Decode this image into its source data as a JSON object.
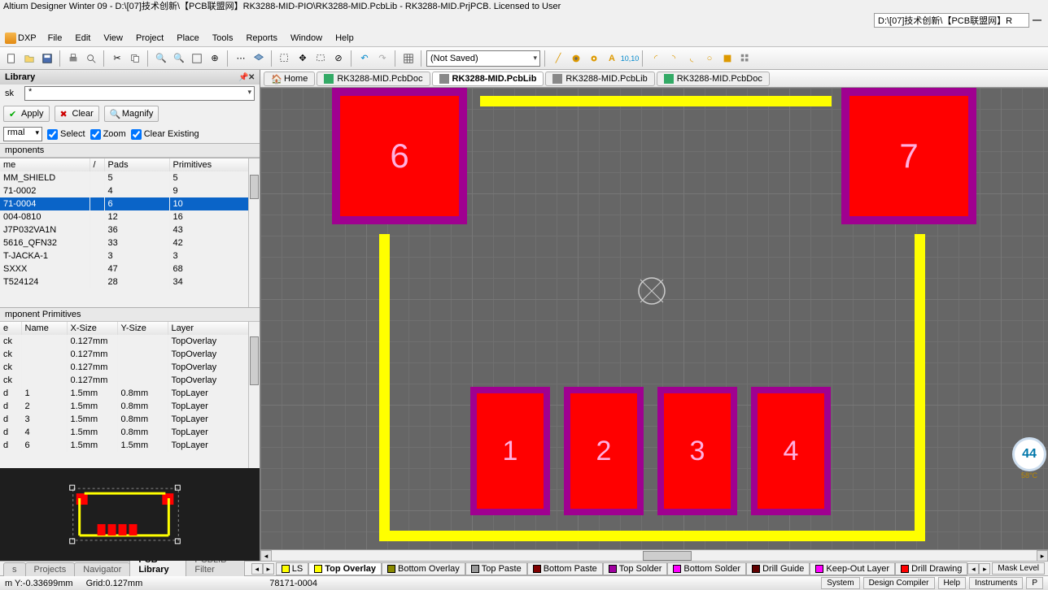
{
  "title": "Altium Designer Winter 09 - D:\\[07]技术创新\\【PCB联盟网】RK3288-MID-PIO\\RK3288-MID.PcbLib - RK3288-MID.PrjPCB. Licensed to User",
  "addr": "D:\\[07]技术创新\\【PCB联盟网】R",
  "menus": {
    "dxp": "DXP",
    "file": "File",
    "edit": "Edit",
    "view": "View",
    "project": "Project",
    "place": "Place",
    "tools": "Tools",
    "reports": "Reports",
    "window": "Window",
    "help": "Help"
  },
  "saved_combo": "(Not Saved)",
  "lib": {
    "title": "Library",
    "mask_label": "sk",
    "mask_value": "*",
    "apply": "Apply",
    "clear": "Clear",
    "magnify": "Magnify",
    "mode": "rmal",
    "chk_select": "Select",
    "chk_zoom": "Zoom",
    "chk_clear": "Clear Existing",
    "components_label": "mponents",
    "cols": {
      "name": "me",
      "pads": "Pads",
      "prims": "Primitives"
    },
    "rows": [
      {
        "name": "MM_SHIELD",
        "pads": "5",
        "prims": "5"
      },
      {
        "name": "71-0002",
        "pads": "4",
        "prims": "9"
      },
      {
        "name": "71-0004",
        "pads": "6",
        "prims": "10"
      },
      {
        "name": "004-0810",
        "pads": "12",
        "prims": "16"
      },
      {
        "name": "J7P032VA1N",
        "pads": "36",
        "prims": "43"
      },
      {
        "name": "5616_QFN32",
        "pads": "33",
        "prims": "42"
      },
      {
        "name": "T-JACKA-1",
        "pads": "3",
        "prims": "3"
      },
      {
        "name": "SXXX",
        "pads": "47",
        "prims": "68"
      },
      {
        "name": "T524124",
        "pads": "28",
        "prims": "34"
      }
    ],
    "prim_label": "mponent Primitives",
    "pcols": {
      "type": "e",
      "name": "Name",
      "xs": "X-Size",
      "ys": "Y-Size",
      "layer": "Layer"
    },
    "prows": [
      {
        "t": "ck",
        "n": "",
        "x": "0.127mm",
        "y": "",
        "l": "TopOverlay"
      },
      {
        "t": "ck",
        "n": "",
        "x": "0.127mm",
        "y": "",
        "l": "TopOverlay"
      },
      {
        "t": "ck",
        "n": "",
        "x": "0.127mm",
        "y": "",
        "l": "TopOverlay"
      },
      {
        "t": "ck",
        "n": "",
        "x": "0.127mm",
        "y": "",
        "l": "TopOverlay"
      },
      {
        "t": "d",
        "n": "1",
        "x": "1.5mm",
        "y": "0.8mm",
        "l": "TopLayer"
      },
      {
        "t": "d",
        "n": "2",
        "x": "1.5mm",
        "y": "0.8mm",
        "l": "TopLayer"
      },
      {
        "t": "d",
        "n": "3",
        "x": "1.5mm",
        "y": "0.8mm",
        "l": "TopLayer"
      },
      {
        "t": "d",
        "n": "4",
        "x": "1.5mm",
        "y": "0.8mm",
        "l": "TopLayer"
      },
      {
        "t": "d",
        "n": "6",
        "x": "1.5mm",
        "y": "1.5mm",
        "l": "TopLayer"
      }
    ]
  },
  "doctabs": {
    "home": "Home",
    "t1": "RK3288-MID.PcbDoc",
    "t2": "RK3288-MID.PcbLib",
    "t3": "RK3288-MID.PcbLib",
    "t4": "RK3288-MID.PcbDoc"
  },
  "pads": {
    "p1": "1",
    "p2": "2",
    "p3": "3",
    "p4": "4",
    "p6": "6",
    "p7": "7"
  },
  "layers": {
    "ls": "LS",
    "top_overlay": "Top Overlay",
    "bot_overlay": "Bottom Overlay",
    "top_paste": "Top Paste",
    "bot_paste": "Bottom Paste",
    "top_solder": "Top Solder",
    "bot_solder": "Bottom Solder",
    "drill_guide": "Drill Guide",
    "keepout": "Keep-Out Layer",
    "drill_draw": "Drill Drawing",
    "mask": "Mask Level"
  },
  "left_tabs": {
    "s": "s",
    "projects": "Projects",
    "navigator": "Navigator",
    "pcblib": "PCB Library",
    "filter": "PCBLIB Filter"
  },
  "status": {
    "coord": "m Y:-0.33699mm",
    "grid": "Grid:0.127mm",
    "comp": "78171-0004",
    "system": "System",
    "design": "Design Compiler",
    "help": "Help",
    "instruments": "Instruments",
    "p": "P"
  },
  "badge": {
    "num": "44",
    "temp": "58°C"
  }
}
